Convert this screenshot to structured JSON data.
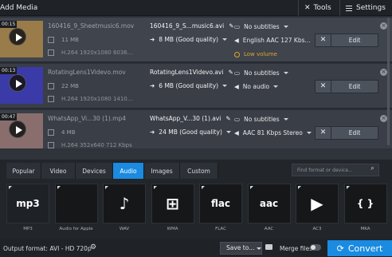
{
  "toolbar": {
    "add_media": "Add Media",
    "tools": "Tools",
    "settings": "Settings"
  },
  "files": [
    {
      "duration": "00:15",
      "name": "160416_9_Sheetmusic6.mov",
      "size": "11 MB",
      "codec": "H.264 1920x1080 6036...",
      "output_name": "160416_9_S...music6.avi",
      "quality": "8 MB (Good quality)",
      "subtitles": "No subtitles",
      "audio": "English AAC 127 Kbs...",
      "warning": "Low volume",
      "edit": "Edit",
      "thumb_color": "#9a7b4a"
    },
    {
      "duration": "00:13",
      "name": "RotatingLens1Videvo.mov",
      "size": "22 MB",
      "codec": "H.264 1920x1080 1410...",
      "output_name": "RotatingLens1Videvo.avi",
      "quality": "6 MB (Good quality)",
      "subtitles": "No subtitles",
      "audio": "No audio",
      "warning": "",
      "edit": "Edit",
      "thumb_color": "#3a3aa8"
    },
    {
      "duration": "00:47",
      "name": "WhatsApp_Vi...30 (1).mp4",
      "size": "4 MB",
      "codec": "H.264 352x640 712 Kbps",
      "output_name": "WhatsApp_V...30 (1).avi",
      "quality": "24 MB (Good quality)",
      "subtitles": "No subtitles",
      "audio": "AAC 81 Kbps Stereo",
      "warning": "",
      "edit": "Edit",
      "thumb_color": "#8a6e6e"
    }
  ],
  "format_tabs": [
    "Popular",
    "Video",
    "Devices",
    "Audio",
    "Images",
    "Custom"
  ],
  "active_tab": "Audio",
  "search_placeholder": "Find format or device...",
  "formats": [
    {
      "label": "MP3",
      "glyph": "mp3"
    },
    {
      "label": "Audio for Apple",
      "glyph": ""
    },
    {
      "label": "WAV",
      "glyph": "♪"
    },
    {
      "label": "WMA",
      "glyph": "⊞"
    },
    {
      "label": "FLAC",
      "glyph": "flac"
    },
    {
      "label": "AAC",
      "glyph": "aac"
    },
    {
      "label": "AC3",
      "glyph": "▶"
    },
    {
      "label": "MKA",
      "glyph": "{ }"
    }
  ],
  "bottom": {
    "output_format": "Output format: AVI - HD 720p",
    "save_to": "Save to...",
    "merge_files": "Merge files",
    "convert": "Convert"
  }
}
